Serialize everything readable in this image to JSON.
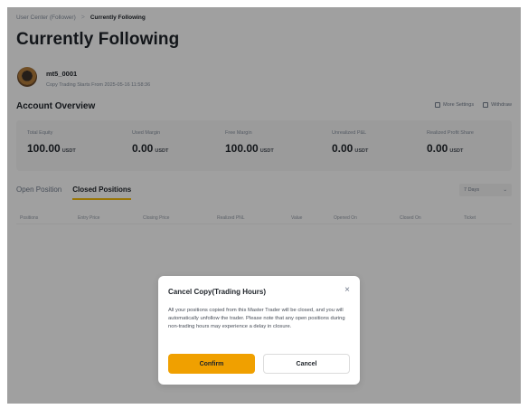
{
  "breadcrumb": {
    "parent": "User Center (Follower)",
    "separator": ">",
    "current": "Currently Following"
  },
  "page_title": "Currently Following",
  "trader": {
    "name": "mt5_0001",
    "since": "Copy Trading Starts From 2025-05-16 11:58:36"
  },
  "overview": {
    "title": "Account Overview",
    "toolbar": {
      "more_settings": "More Settings",
      "withdraw": "Withdraw"
    },
    "metrics": [
      {
        "label": "Total Equity",
        "value": "100.00",
        "unit": "USDT"
      },
      {
        "label": "Used Margin",
        "value": "0.00",
        "unit": "USDT"
      },
      {
        "label": "Free Margin",
        "value": "100.00",
        "unit": "USDT"
      },
      {
        "label": "Unrealized P&L",
        "value": "0.00",
        "unit": "USDT"
      },
      {
        "label": "Realized Profit Share",
        "value": "0.00",
        "unit": "USDT"
      }
    ]
  },
  "positions": {
    "tabs": [
      {
        "label": "Open Position",
        "active": false
      },
      {
        "label": "Closed Positions",
        "active": true
      }
    ],
    "range": {
      "selected": "7 Days"
    },
    "columns": [
      "Positions",
      "Entry Price",
      "Closing Price",
      "Realized PNL",
      "Value",
      "Opened On",
      "Closed On",
      "Ticket"
    ]
  },
  "modal": {
    "title": "Cancel Copy(Trading Hours)",
    "body": "All your positions copied from this Master Trader will be closed, and you will automatically unfollow the trader. Please note that any open positions during non-trading hours may experience a delay in closure.",
    "confirm": "Confirm",
    "cancel": "Cancel"
  },
  "colors": {
    "accent": "#f0a000",
    "tab_underline": "#f0b90b",
    "overlay": "rgba(0,0,0,0.36)"
  }
}
